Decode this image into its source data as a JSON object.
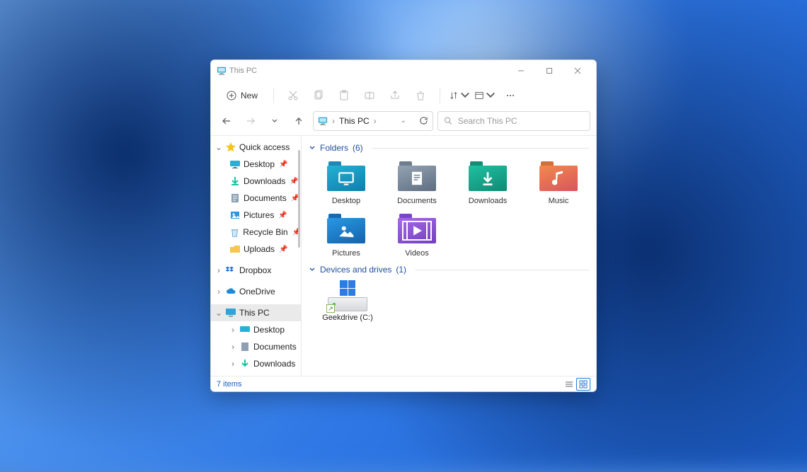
{
  "window": {
    "title": "This PC"
  },
  "toolbar": {
    "new_label": "New"
  },
  "address": {
    "breadcrumb": "This PC"
  },
  "search": {
    "placeholder": "Search This PC"
  },
  "sidebar": {
    "quick_access": {
      "label": "Quick access"
    },
    "quick_items": [
      {
        "label": "Desktop"
      },
      {
        "label": "Downloads"
      },
      {
        "label": "Documents"
      },
      {
        "label": "Pictures"
      },
      {
        "label": "Recycle Bin"
      },
      {
        "label": "Uploads"
      }
    ],
    "dropbox": {
      "label": "Dropbox"
    },
    "onedrive": {
      "label": "OneDrive"
    },
    "this_pc": {
      "label": "This PC"
    },
    "this_pc_children": [
      {
        "label": "Desktop"
      },
      {
        "label": "Documents"
      },
      {
        "label": "Downloads"
      }
    ]
  },
  "groups": {
    "folders": {
      "title": "Folders",
      "count": "(6)"
    },
    "drives": {
      "title": "Devices and drives",
      "count": "(1)"
    }
  },
  "folders": [
    {
      "label": "Desktop"
    },
    {
      "label": "Documents"
    },
    {
      "label": "Downloads"
    },
    {
      "label": "Music"
    },
    {
      "label": "Pictures"
    },
    {
      "label": "Videos"
    }
  ],
  "drives": [
    {
      "label": "Geekdrive (C:)"
    }
  ],
  "status": {
    "item_count": "7 items"
  }
}
